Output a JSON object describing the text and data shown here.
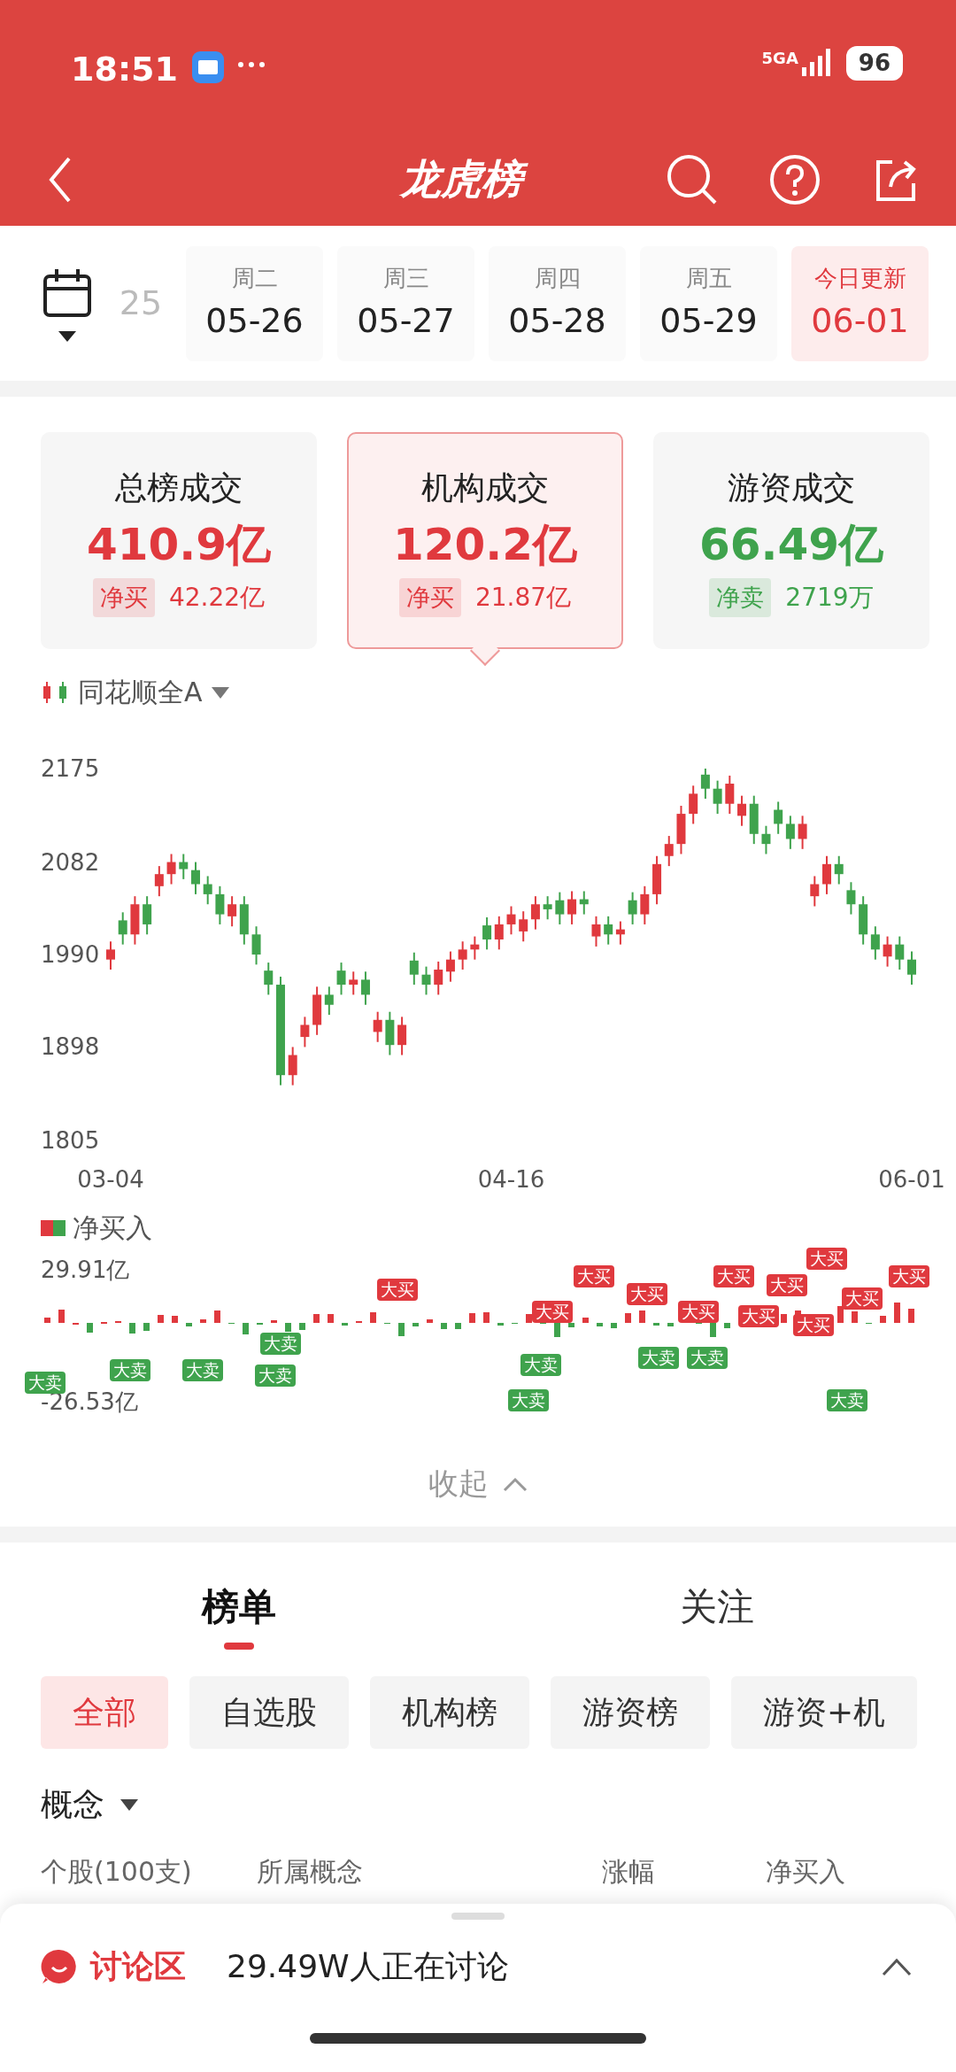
{
  "status_bar": {
    "time": "18:51",
    "network": "5GA",
    "battery": "96"
  },
  "header": {
    "title": "龙虎榜"
  },
  "dates": [
    {
      "date": "25",
      "selected": false
    },
    {
      "weekday": "周二",
      "date": "05-26",
      "selected": false
    },
    {
      "weekday": "周三",
      "date": "05-27",
      "selected": false
    },
    {
      "weekday": "周四",
      "date": "05-28",
      "selected": false
    },
    {
      "weekday": "周五",
      "date": "05-29",
      "selected": false
    },
    {
      "weekday": "今日更新",
      "date": "06-01",
      "selected": true
    }
  ],
  "summary_cards": [
    {
      "title": "总榜成交",
      "amount": "410.9亿",
      "tag": "净买",
      "tag_value": "42.22亿",
      "color": "#e0393e",
      "selected": false
    },
    {
      "title": "机构成交",
      "amount": "120.2亿",
      "tag": "净买",
      "tag_value": "21.87亿",
      "color": "#e0393e",
      "selected": true
    },
    {
      "title": "游资成交",
      "amount": "66.49亿",
      "tag": "净卖",
      "tag_value": "2719万",
      "color": "#3fa34d",
      "selected": false
    }
  ],
  "index_chart": {
    "index_name": "同花顺全A",
    "chart_data": {
      "type": "candlestick",
      "ylim": [
        1805,
        2175
      ],
      "yticks": [
        {
          "value": 2175,
          "label": "2175"
        },
        {
          "value": 2082,
          "label": "2082"
        },
        {
          "value": 1990,
          "label": "1990"
        },
        {
          "value": 1898,
          "label": "1898"
        },
        {
          "value": 1805,
          "label": "1805"
        }
      ],
      "categories": [
        "03-04",
        null,
        null,
        null,
        null,
        null,
        null,
        null,
        null,
        null,
        null,
        null,
        null,
        null,
        null,
        null,
        null,
        null,
        null,
        null,
        null,
        null,
        null,
        null,
        null,
        null,
        null,
        null,
        null,
        null,
        null,
        null,
        null,
        "04-16",
        null,
        null,
        null,
        null,
        null,
        null,
        null,
        null,
        null,
        null,
        null,
        null,
        null,
        null,
        null,
        null,
        null,
        null,
        null,
        null,
        null,
        null,
        null,
        null,
        null,
        null,
        null,
        null,
        null,
        null,
        null,
        null,
        "06-01"
      ],
      "ohlc": [
        [
          1985,
          2003,
          1975,
          1995
        ],
        [
          2024,
          2032,
          2000,
          2010
        ],
        [
          2010,
          2048,
          2000,
          2040
        ],
        [
          2040,
          2048,
          2010,
          2020
        ],
        [
          2058,
          2078,
          2048,
          2070
        ],
        [
          2070,
          2090,
          2060,
          2082
        ],
        [
          2082,
          2090,
          2065,
          2075
        ],
        [
          2074,
          2082,
          2050,
          2060
        ],
        [
          2060,
          2068,
          2040,
          2050
        ],
        [
          2050,
          2058,
          2020,
          2030
        ],
        [
          2028,
          2048,
          2018,
          2040
        ],
        [
          2040,
          2048,
          2000,
          2010
        ],
        [
          2010,
          2018,
          1980,
          1990
        ],
        [
          1974,
          1982,
          1950,
          1960
        ],
        [
          1960,
          1968,
          1860,
          1870
        ],
        [
          1870,
          1898,
          1860,
          1890
        ],
        [
          1908,
          1928,
          1898,
          1920
        ],
        [
          1920,
          1958,
          1910,
          1950
        ],
        [
          1950,
          1958,
          1930,
          1940
        ],
        [
          1974,
          1982,
          1950,
          1960
        ],
        [
          1960,
          1973,
          1950,
          1965
        ],
        [
          1965,
          1973,
          1940,
          1950
        ],
        [
          1913,
          1933,
          1903,
          1925
        ],
        [
          1925,
          1933,
          1890,
          1900
        ],
        [
          1900,
          1928,
          1890,
          1920
        ],
        [
          1984,
          1992,
          1960,
          1970
        ],
        [
          1970,
          1978,
          1950,
          1960
        ],
        [
          1960,
          1983,
          1950,
          1975
        ],
        [
          1973,
          1993,
          1963,
          1985
        ],
        [
          1985,
          2003,
          1975,
          1995
        ],
        [
          1995,
          2008,
          1985,
          2000
        ],
        [
          2019,
          2027,
          1995,
          2005
        ],
        [
          2005,
          2028,
          1995,
          2020
        ],
        [
          2020,
          2038,
          2010,
          2030
        ],
        [
          2013,
          2033,
          2003,
          2025
        ],
        [
          2025,
          2048,
          2015,
          2040
        ],
        [
          2040,
          2048,
          2025,
          2035
        ],
        [
          2044,
          2052,
          2020,
          2030
        ],
        [
          2030,
          2053,
          2020,
          2045
        ],
        [
          2045,
          2053,
          2030,
          2040
        ],
        [
          2008,
          2028,
          1998,
          2020
        ],
        [
          2020,
          2028,
          2000,
          2010
        ],
        [
          2010,
          2023,
          2000,
          2015
        ],
        [
          2044,
          2052,
          2020,
          2030
        ],
        [
          2030,
          2058,
          2020,
          2050
        ],
        [
          2050,
          2088,
          2040,
          2080
        ],
        [
          2088,
          2108,
          2078,
          2100
        ],
        [
          2100,
          2138,
          2090,
          2130
        ],
        [
          2130,
          2158,
          2120,
          2150
        ],
        [
          2169,
          2175,
          2145,
          2155
        ],
        [
          2155,
          2163,
          2130,
          2140
        ],
        [
          2140,
          2168,
          2130,
          2160
        ],
        [
          2128,
          2148,
          2118,
          2140
        ],
        [
          2140,
          2148,
          2100,
          2110
        ],
        [
          2110,
          2118,
          2090,
          2100
        ],
        [
          2134,
          2142,
          2110,
          2120
        ],
        [
          2120,
          2128,
          2095,
          2105
        ],
        [
          2105,
          2128,
          2095,
          2120
        ],
        [
          2048,
          2068,
          2038,
          2060
        ],
        [
          2060,
          2088,
          2050,
          2080
        ],
        [
          2080,
          2088,
          2060,
          2070
        ],
        [
          2054,
          2062,
          2030,
          2040
        ],
        [
          2040,
          2048,
          2000,
          2010
        ],
        [
          2010,
          2018,
          1985,
          1995
        ],
        [
          1988,
          2008,
          1978,
          2000
        ],
        [
          2000,
          2008,
          1975,
          1985
        ],
        [
          1985,
          1993,
          1960,
          1970
        ]
      ]
    }
  },
  "net_chart": {
    "legend": "净买入",
    "max_label": "29.91亿",
    "min_label": "-26.53亿",
    "markers": [
      {
        "kind": "sell",
        "label": "大卖"
      },
      {
        "kind": "sell",
        "label": "大卖"
      },
      {
        "kind": "sell",
        "label": "大卖"
      },
      {
        "kind": "sell",
        "label": "大卖"
      },
      {
        "kind": "sell",
        "label": "大卖"
      },
      {
        "kind": "buy",
        "label": "大买"
      },
      {
        "kind": "sell",
        "label": "大卖"
      },
      {
        "kind": "sell",
        "label": "大卖"
      },
      {
        "kind": "buy",
        "label": "大买"
      },
      {
        "kind": "buy",
        "label": "大买"
      },
      {
        "kind": "buy",
        "label": "大买"
      },
      {
        "kind": "sell",
        "label": "大卖"
      },
      {
        "kind": "sell",
        "label": "大卖"
      },
      {
        "kind": "buy",
        "label": "大买"
      },
      {
        "kind": "buy",
        "label": "大买"
      },
      {
        "kind": "buy",
        "label": "大买"
      },
      {
        "kind": "buy",
        "label": "大买"
      },
      {
        "kind": "buy",
        "label": "大买"
      },
      {
        "kind": "sell",
        "label": "大卖"
      },
      {
        "kind": "buy",
        "label": "大买"
      },
      {
        "kind": "buy",
        "label": "大买"
      },
      {
        "kind": "buy",
        "label": "大买"
      }
    ]
  },
  "collapse": {
    "label": "收起"
  },
  "main_tabs": [
    {
      "label": "榜单",
      "selected": true
    },
    {
      "label": "关注",
      "selected": false
    }
  ],
  "filters": [
    {
      "label": "全部",
      "selected": true
    },
    {
      "label": "自选股",
      "selected": false
    },
    {
      "label": "机构榜",
      "selected": false
    },
    {
      "label": "游资榜",
      "selected": false
    },
    {
      "label": "游资+机",
      "selected": false
    }
  ],
  "category": {
    "label": "概念"
  },
  "table": {
    "columns": [
      "个股(100支)",
      "所属概念",
      "涨幅",
      "净买入"
    ]
  },
  "discussion": {
    "title": "讨论区",
    "count_text": "29.49W人正在讨论"
  }
}
